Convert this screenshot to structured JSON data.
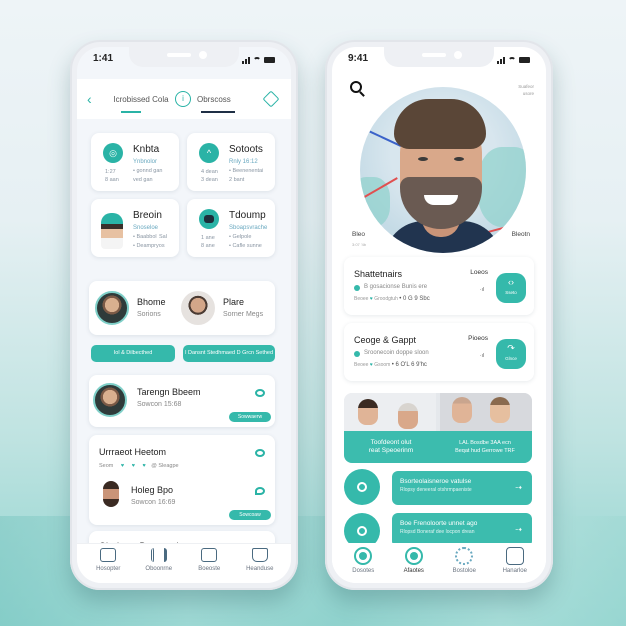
{
  "left_phone": {
    "status": {
      "time": "1:41"
    },
    "header": {
      "back_icon": "chevron-left-icon",
      "tab1": "Icrobissed Cola",
      "info_icon": "info-icon",
      "tab2": "Obrscoss",
      "tag_icon": "tag-icon"
    },
    "grid_cards": [
      {
        "title": "Knbta",
        "sub": "Ynbnolor",
        "line1": "• gonnd gan",
        "line2": "ved gan",
        "meta1": "1:27",
        "meta2": "8 aan"
      },
      {
        "title": "Sotoots",
        "sub": "Rnly 16:12",
        "line1": "• Beenenentai",
        "line2": "2 bant",
        "meta1": "4 dean",
        "meta2": "3 dean"
      },
      {
        "title": "Breoin",
        "sub": "Snoseloe",
        "line1": "• Baabbol",
        "line2": "• Deampryos",
        "meta1": "Sal",
        "meta2": ""
      },
      {
        "title": "Tdoump",
        "sub": "Sboapsvrache",
        "line1": "• Gelpole",
        "line2": "• Cafle sunne",
        "meta1": "1 ane",
        "meta2": "8 ane"
      }
    ],
    "people": [
      {
        "name": "Bhome",
        "role": "Sorions"
      },
      {
        "name": "Plare",
        "role": "Sorner Megs"
      }
    ],
    "buttons": [
      {
        "label": "Iol & Dilbecthed"
      },
      {
        "label": "I Dansnt Stedhmaed D Grcn Sethed"
      }
    ],
    "contacts": [
      {
        "name": "Tarengn Bbeem",
        "sub": "Sowcon 15:68",
        "pill": "Sowwaerw"
      },
      {
        "section": "Urrraeot Heetom",
        "meta": "Seom",
        "meta2": "@ Sleagpe",
        "name": "Holeg Bpo",
        "sub": "Sowcon 16:69",
        "pill": "Sowcoaw"
      },
      {
        "section": "Olschsert Beesssatier"
      }
    ],
    "nav": [
      {
        "label": "Hosopter",
        "icon": "home-icon"
      },
      {
        "label": "Oboonrne",
        "icon": "chart-icon"
      },
      {
        "label": "Boeoste",
        "icon": "card-icon"
      },
      {
        "label": "Heanduse",
        "icon": "clipboard-icon"
      }
    ]
  },
  "right_phone": {
    "status": {
      "time": "9:41"
    },
    "search_icon": "search-icon",
    "topright": [
      "Suafeor",
      "usore"
    ],
    "hero_labels": {
      "left": "Bleo",
      "left_sub": "3:07 '4b",
      "right": "Bleotn"
    },
    "cards": [
      {
        "title": "Shattetnairs",
        "label": "Loeos",
        "line": "B gosacionse Bunis ere",
        "meta": "Beoee",
        "meta2": "Groodgtuh",
        "value": "• 0 G 9 Sbc",
        "mini": "·ıl",
        "action_label": "Sseto"
      },
      {
        "title": "Ceoge & Gappt",
        "label": "Pioeos",
        "line": "Sroonecoin doppe sloon",
        "meta": "Beoee",
        "meta2": "Gsoom",
        "value": "• 6 O'L 6 9'hc",
        "mini": "·ıl",
        "action_label": "Glnce"
      }
    ],
    "gallery": [
      {
        "caption": "Toofdeont olut\nreat Speoerinm"
      },
      {
        "caption": "LAL Bosdbe 3AA ecn\nBeqat hud Gerrowe TRF"
      }
    ],
    "actions": [
      {
        "title": "Bsorteolaisneroe vatulse",
        "sub": "Rlopsy deneeral otshrmpaeniste"
      },
      {
        "title": "Boe Frenoloorte unnet ago",
        "sub": "Rlopsd Boneraf dee locpon drean"
      }
    ],
    "nav": [
      {
        "label": "Dosotes",
        "icon": "target-icon"
      },
      {
        "label": "Afaotes",
        "icon": "record-icon"
      },
      {
        "label": "Bostoloe",
        "icon": "network-icon"
      },
      {
        "label": "Hanarloe",
        "icon": "edit-box-icon"
      }
    ]
  }
}
